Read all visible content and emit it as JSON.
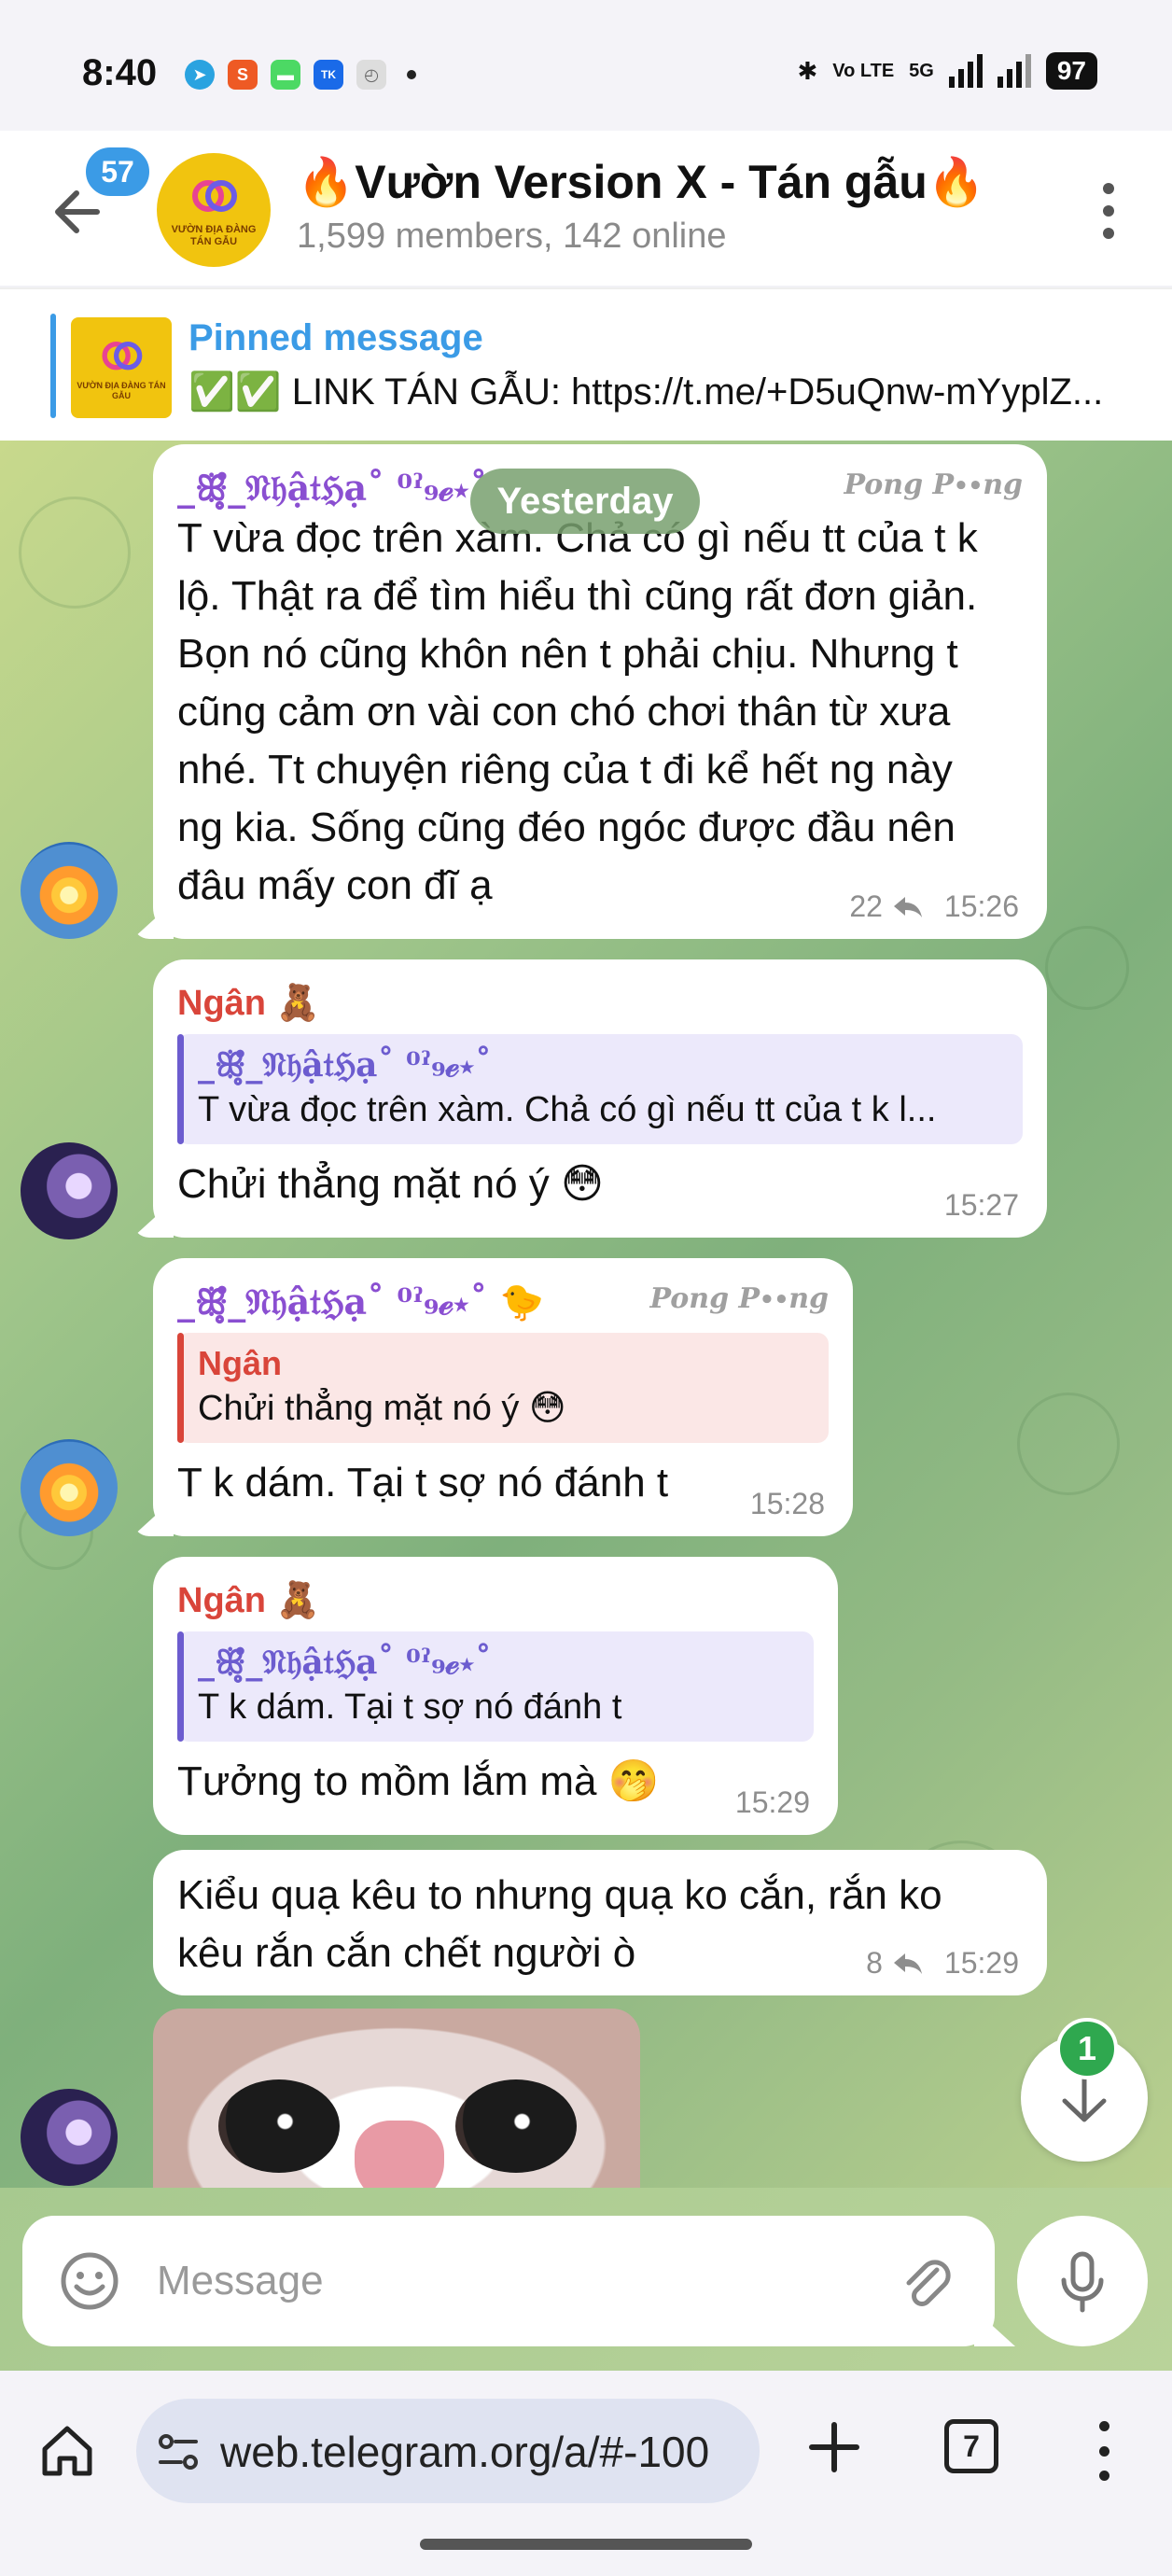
{
  "status_bar": {
    "time": "8:40",
    "network_label": "Vo LTE",
    "signal_label": "5G",
    "battery": "97"
  },
  "header": {
    "unread_count": "57",
    "avatar_text": "VƯỜN ĐỊA ĐÀNG TÁN GẪU",
    "title": "🔥Vườn Version X - Tán gẫu🔥",
    "subtitle": "1,599 members, 142 online"
  },
  "pinned": {
    "label": "Pinned message",
    "text": "✅✅ LINK TÁN GẪU: https://t.me/+D5uQnw-mYyplZ..."
  },
  "chat": {
    "date_separator": "Yesterday",
    "messages": [
      {
        "sender": "_ꕥ̥̊_𝔑𝔥ậ𝔱ℌạ˚ ⁰ˀ₉ℯ⋆˚",
        "tag": "Pong P∙∙ng",
        "text": "T vừa đọc trên xàm. Chả có gì nếu tt của t k lộ. Thật ra để tìm hiểu thì cũng rất đơn giản. Bọn nó cũng khôn nên t phải chịu. Nhưng t cũng cảm ơn vài con chó chơi thân từ xưa nhé. Tt chuyện riêng của t đi kể hết ng này ng kia. Sống cũng đéo ngóc được đầu nên đâu mấy con đĩ ạ",
        "replies": "22",
        "time": "15:26"
      },
      {
        "sender": "Ngân 🧸",
        "quote_name": "_ꕥ̥̊_𝔑𝔥ậ𝔱ℌạ˚ ⁰ˀ₉ℯ⋆˚",
        "quote_text": "T vừa đọc trên xàm. Chả có gì nếu tt của t k l...",
        "text": "Chửi thẳng mặt nó ý 😳",
        "time": "15:27"
      },
      {
        "sender": "_ꕥ̥̊_𝔑𝔥ậ𝔱ℌạ˚ ⁰ˀ₉ℯ⋆˚ 🐤",
        "tag": "Pong P∙∙ng",
        "quote_name": "Ngân",
        "quote_text": "Chửi thẳng mặt nó ý 😳",
        "text": "T k dám. Tại t sợ nó đánh t",
        "time": "15:28"
      },
      {
        "sender": "Ngân 🧸",
        "quote_name": "_ꕥ̥̊_𝔑𝔥ậ𝔱ℌạ˚ ⁰ˀ₉ℯ⋆˚",
        "quote_text": "T k dám. Tại t sợ nó đánh t",
        "text": "Tưởng to mồm lắm mà 🤭",
        "time": "15:29"
      },
      {
        "text": "Kiểu quạ kêu to nhưng quạ ko cắn, rắn ko kêu rắn cắn chết người ò",
        "replies": "8",
        "time": "15:29"
      }
    ],
    "scroll_badge": "1"
  },
  "composer": {
    "placeholder": "Message"
  },
  "browser": {
    "url": "web.telegram.org/a/#-100",
    "tab_count": "7"
  },
  "colors": {
    "accent": "#3b9be6",
    "sender_purple": "#8a4fd1",
    "sender_red": "#d9453a",
    "quote_violet": "#6c5ccf",
    "badge_green": "#2fa84f"
  }
}
